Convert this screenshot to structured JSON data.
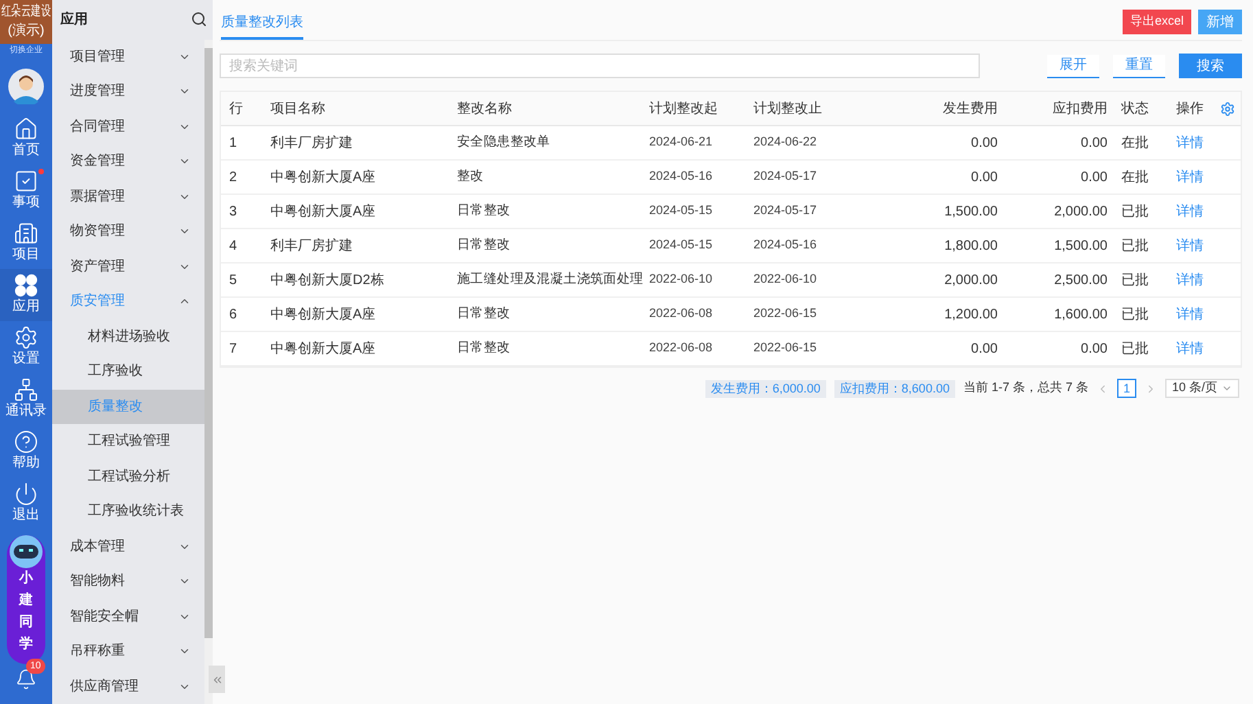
{
  "brand": {
    "name": "红朵云建设",
    "suffix": "(演示)",
    "switch": "切换企业"
  },
  "rail": [
    {
      "label": "首页",
      "kind": "home",
      "selected": false,
      "dot": false
    },
    {
      "label": "事项",
      "kind": "check",
      "selected": false,
      "dot": true
    },
    {
      "label": "项目",
      "kind": "building",
      "selected": false,
      "dot": false
    },
    {
      "label": "应用",
      "kind": "apps",
      "selected": true,
      "dot": false
    },
    {
      "label": "设置",
      "kind": "gear",
      "selected": false,
      "dot": false
    },
    {
      "label": "通讯录",
      "kind": "org",
      "selected": false,
      "dot": false
    },
    {
      "label": "帮助",
      "kind": "help",
      "selected": false,
      "dot": false
    },
    {
      "label": "退出",
      "kind": "power",
      "selected": false,
      "dot": false
    }
  ],
  "assistant": {
    "chars": [
      "小",
      "建",
      "同",
      "学"
    ]
  },
  "notifications": {
    "count": "10"
  },
  "menu": {
    "title": "应用",
    "items": [
      {
        "label": "项目管理",
        "expanded": false,
        "selected": false
      },
      {
        "label": "进度管理",
        "expanded": false,
        "selected": false
      },
      {
        "label": "合同管理",
        "expanded": false,
        "selected": false
      },
      {
        "label": "资金管理",
        "expanded": false,
        "selected": false
      },
      {
        "label": "票据管理",
        "expanded": false,
        "selected": false
      },
      {
        "label": "物资管理",
        "expanded": false,
        "selected": false
      },
      {
        "label": "资产管理",
        "expanded": false,
        "selected": false
      },
      {
        "label": "质安管理",
        "expanded": true,
        "selected": true,
        "children": [
          {
            "label": "材料进场验收",
            "selected": false
          },
          {
            "label": "工序验收",
            "selected": false
          },
          {
            "label": "质量整改",
            "selected": true
          },
          {
            "label": "工程试验管理",
            "selected": false
          },
          {
            "label": "工程试验分析",
            "selected": false
          },
          {
            "label": "工序验收统计表",
            "selected": false
          }
        ]
      },
      {
        "label": "成本管理",
        "expanded": false,
        "selected": false
      },
      {
        "label": "智能物料",
        "expanded": false,
        "selected": false
      },
      {
        "label": "智能安全帽",
        "expanded": false,
        "selected": false
      },
      {
        "label": "吊秤称重",
        "expanded": false,
        "selected": false
      },
      {
        "label": "供应商管理",
        "expanded": false,
        "selected": false
      }
    ]
  },
  "tabs": [
    {
      "label": "质量整改列表",
      "selected": true
    }
  ],
  "actions": {
    "export": "导出excel",
    "add": "新增"
  },
  "search": {
    "placeholder": "搜索关键词",
    "expand": "展开",
    "reset": "重置",
    "submit": "搜索"
  },
  "table": {
    "columns": [
      "行",
      "项目名称",
      "整改名称",
      "计划整改起",
      "计划整改止",
      "发生费用",
      "应扣费用",
      "状态",
      "操作"
    ],
    "rows": [
      [
        "1",
        "利丰厂房扩建",
        "安全隐患整改单",
        "2024-06-21",
        "2024-06-22",
        "0.00",
        "0.00",
        "在批",
        "详情"
      ],
      [
        "2",
        "中粤创新大厦A座",
        "整改",
        "2024-05-16",
        "2024-05-17",
        "0.00",
        "0.00",
        "在批",
        "详情"
      ],
      [
        "3",
        "中粤创新大厦A座",
        "日常整改",
        "2024-05-15",
        "2024-05-17",
        "1,500.00",
        "2,000.00",
        "已批",
        "详情"
      ],
      [
        "4",
        "利丰厂房扩建",
        "日常整改",
        "2024-05-15",
        "2024-05-16",
        "1,800.00",
        "1,500.00",
        "已批",
        "详情"
      ],
      [
        "5",
        "中粤创新大厦D2栋",
        "施工缝处理及混凝土浇筑面处理",
        "2022-06-10",
        "2022-06-10",
        "2,000.00",
        "2,500.00",
        "已批",
        "详情"
      ],
      [
        "6",
        "中粤创新大厦A座",
        "日常整改",
        "2022-06-08",
        "2022-06-15",
        "1,200.00",
        "1,600.00",
        "已批",
        "详情"
      ],
      [
        "7",
        "中粤创新大厦A座",
        "日常整改",
        "2022-06-08",
        "2022-06-15",
        "0.00",
        "0.00",
        "已批",
        "详情"
      ]
    ]
  },
  "footer": {
    "cost": "发生费用：6,000.00",
    "deduct": "应扣费用：8,600.00",
    "range": "当前 1-7 条，总共 7 条",
    "page": "1",
    "page_size": "10 条/页"
  }
}
